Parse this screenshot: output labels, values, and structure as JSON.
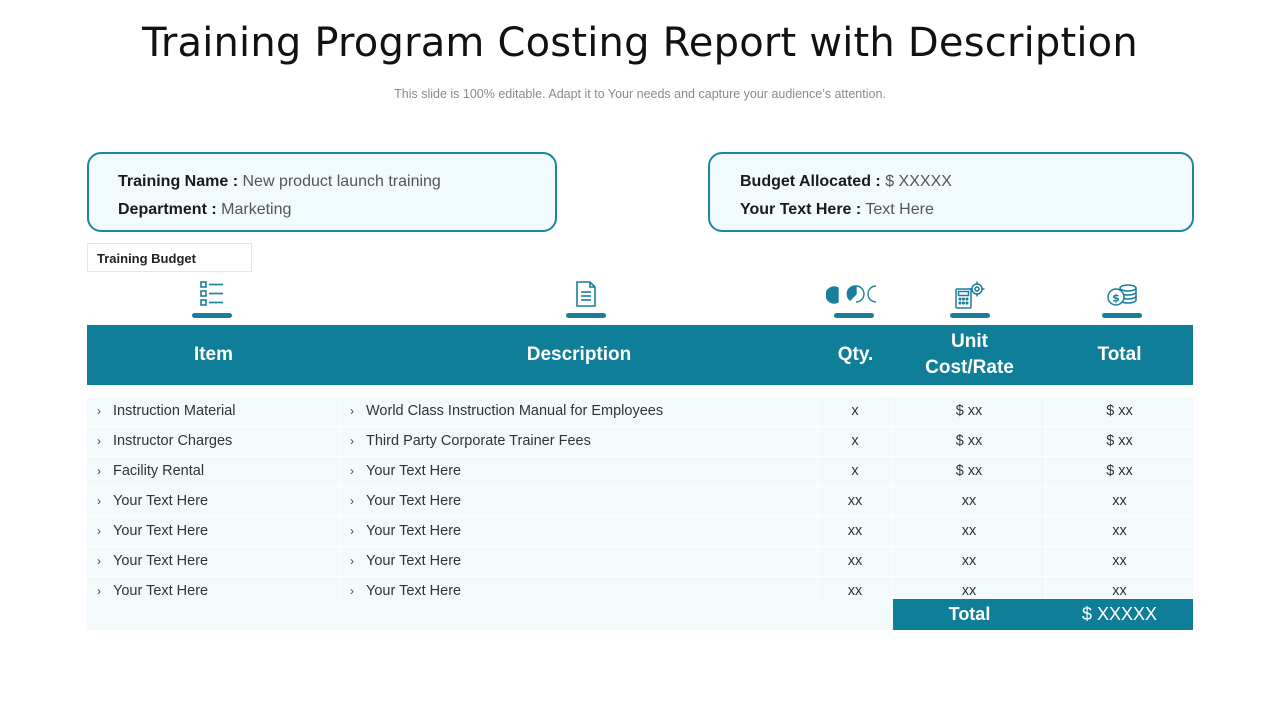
{
  "header": {
    "title": "Training Program Costing Report with Description",
    "subtitle": "This slide is 100% editable. Adapt it to Your needs and capture your audience’s attention."
  },
  "info_left": {
    "training_name_label": "Training Name :",
    "training_name_value": "New product launch training",
    "department_label": "Department :",
    "department_value": "Marketing"
  },
  "info_right": {
    "budget_label": "Budget Allocated :",
    "budget_value": "$ XXXXX",
    "text_label": "Your Text Here :",
    "text_value": "Text Here"
  },
  "budget_tag": "Training Budget",
  "icons": [
    "list-icon",
    "document-icon",
    "pie-segments-icon",
    "calculator-gear-icon",
    "coins-icon"
  ],
  "columns": {
    "item": "Item",
    "description": "Description",
    "qty": "Qty.",
    "unit_cost_line1": "Unit",
    "unit_cost_line2": "Cost/Rate",
    "total": "Total"
  },
  "rows": [
    {
      "item": "Instruction Material",
      "description": "World Class Instruction Manual for Employees",
      "qty": "x",
      "unit": "$ xx",
      "total": "$ xx"
    },
    {
      "item": "Instructor Charges",
      "description": "Third Party Corporate Trainer Fees",
      "qty": "x",
      "unit": "$ xx",
      "total": "$ xx"
    },
    {
      "item": "Facility Rental",
      "description": "Your Text Here",
      "qty": "x",
      "unit": "$ xx",
      "total": "$ xx"
    },
    {
      "item": "Your Text Here",
      "description": "Your Text Here",
      "qty": "xx",
      "unit": "xx",
      "total": "xx"
    },
    {
      "item": "Your Text Here",
      "description": "Your Text Here",
      "qty": "xx",
      "unit": "xx",
      "total": "xx"
    },
    {
      "item": "Your Text Here",
      "description": "Your Text Here",
      "qty": "xx",
      "unit": "xx",
      "total": "xx"
    },
    {
      "item": "Your Text Here",
      "description": "Your Text Here",
      "qty": "xx",
      "unit": "xx",
      "total": "xx"
    }
  ],
  "footer": {
    "total_label": "Total",
    "total_value": "$ XXXXX"
  },
  "colors": {
    "accent": "#0f7f99",
    "border": "#1e86a0",
    "row_bg": "#f2fafc"
  }
}
